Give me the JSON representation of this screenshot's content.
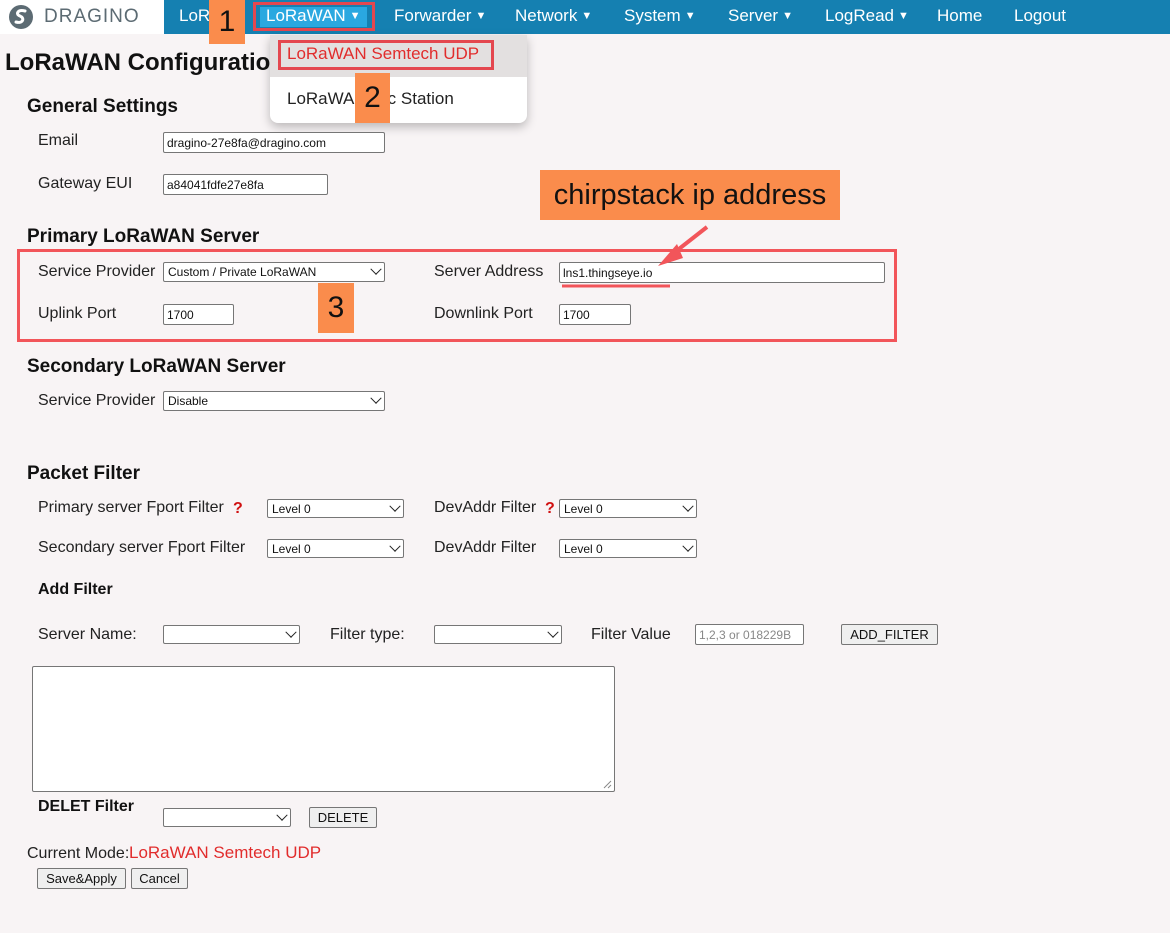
{
  "nav": {
    "logo_text": "DRAGINO",
    "items": [
      {
        "label": "LoR",
        "dropdown": false
      },
      {
        "label": "LoRaWAN",
        "dropdown": true
      },
      {
        "label": "Forwarder",
        "dropdown": true
      },
      {
        "label": "Network",
        "dropdown": true
      },
      {
        "label": "System",
        "dropdown": true
      },
      {
        "label": "Server",
        "dropdown": true
      },
      {
        "label": "LogRead",
        "dropdown": true
      },
      {
        "label": "Home",
        "dropdown": false
      },
      {
        "label": "Logout",
        "dropdown": false
      }
    ],
    "caret": "▼"
  },
  "dropdown": {
    "items": [
      "LoRaWAN Semtech UDP",
      "LoRaWA",
      "sic Station"
    ]
  },
  "callouts": {
    "one": "1",
    "two": "2",
    "three": "3",
    "chirpstack": "chirpstack ip address"
  },
  "page": {
    "title": "LoRaWAN Configuratio"
  },
  "general": {
    "heading": "General Settings",
    "email_label": "Email",
    "email_value": "dragino-27e8fa@dragino.com",
    "eui_label": "Gateway EUI",
    "eui_value": "a84041fdfe27e8fa"
  },
  "primary": {
    "heading": "Primary LoRaWAN Server",
    "provider_label": "Service Provider",
    "provider_value": "Custom / Private LoRaWAN",
    "address_label": "Server Address",
    "address_value": "lns1.thingseye.io",
    "uplink_label": "Uplink Port",
    "uplink_value": "1700",
    "downlink_label": "Downlink Port",
    "downlink_value": "1700"
  },
  "secondary": {
    "heading": "Secondary LoRaWAN Server",
    "provider_label": "Service Provider",
    "provider_value": "Disable"
  },
  "packet_filter": {
    "heading": "Packet Filter",
    "primary_fport_label": "Primary server Fport Filter",
    "primary_fport_value": "Level 0",
    "devaddr_label": "DevAddr Filter",
    "primary_devaddr_value": "Level 0",
    "secondary_fport_label": "Secondary server Fport Filter",
    "secondary_fport_value": "Level 0",
    "secondary_devaddr_value": "Level 0",
    "help_mark": "?"
  },
  "add_filter": {
    "heading": "Add Filter",
    "server_name_label": "Server Name:",
    "server_name_value": "",
    "filter_type_label": "Filter type:",
    "filter_type_value": "",
    "filter_value_label": "Filter Value",
    "filter_value_placeholder": "1,2,3 or 018229B",
    "add_button": "ADD_FILTER"
  },
  "delete_filter": {
    "heading": "DELET Filter",
    "select_value": "",
    "delete_button": "DELETE"
  },
  "status": {
    "current_mode_label": "Current Mode:",
    "current_mode_value": "LoRaWAN Semtech UDP"
  },
  "actions": {
    "save_apply": "Save&Apply",
    "cancel": "Cancel"
  },
  "colors": {
    "nav_bg": "#1580b1",
    "accent_red": "#e12c2c",
    "callout_orange": "#fa8c4c",
    "highlight_border": "#f2555a"
  }
}
